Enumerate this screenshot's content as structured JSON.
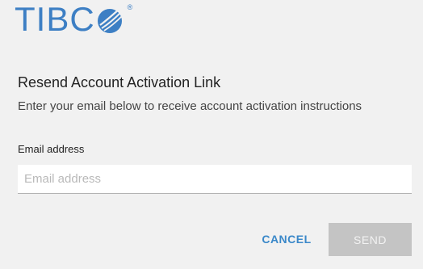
{
  "brand": {
    "logo_text": "TIBC",
    "logo_mark_icon": "tibco-orb-icon",
    "registered_symbol": "®",
    "color": "#3d7fc4"
  },
  "dialog": {
    "title": "Resend Account Activation Link",
    "subtitle": "Enter your email below to receive account activation instructions",
    "email_label": "Email address",
    "email_placeholder": "Email address",
    "email_value": ""
  },
  "actions": {
    "cancel_label": "CANCEL",
    "send_label": "SEND",
    "cancel_color": "#3a88c9",
    "send_disabled_color": "#c4c4c4"
  }
}
